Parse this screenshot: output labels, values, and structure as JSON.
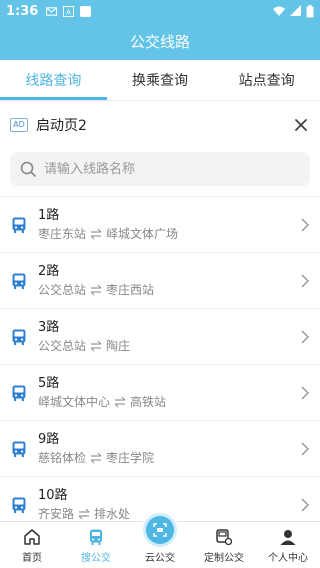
{
  "status": {
    "time": "1:36"
  },
  "header": {
    "title": "公交线路"
  },
  "tabs": [
    {
      "label": "线路查询"
    },
    {
      "label": "换乘查询"
    },
    {
      "label": "站点查询"
    }
  ],
  "ad": {
    "badge": "AD",
    "title": "启动页2"
  },
  "search": {
    "placeholder": "请输入线路名称",
    "value": ""
  },
  "routes": [
    {
      "name": "1路",
      "from": "枣庄东站",
      "to": "峄城文体广场"
    },
    {
      "name": "2路",
      "from": "公交总站",
      "to": "枣庄西站"
    },
    {
      "name": "3路",
      "from": "公交总站",
      "to": "陶庄"
    },
    {
      "name": "5路",
      "from": "峄城文体中心",
      "to": "高铁站"
    },
    {
      "name": "9路",
      "from": "慈铭体检",
      "to": "枣庄学院"
    },
    {
      "name": "10路",
      "from": "齐安路",
      "to": "排水处"
    }
  ],
  "nav": [
    {
      "label": "首页"
    },
    {
      "label": "搜公交"
    },
    {
      "label": "云公交"
    },
    {
      "label": "定制公交"
    },
    {
      "label": "个人中心"
    }
  ],
  "colors": {
    "primary": "#63c4e8",
    "accent": "#4eb6e2",
    "bus_icon": "#2f7fd1"
  }
}
